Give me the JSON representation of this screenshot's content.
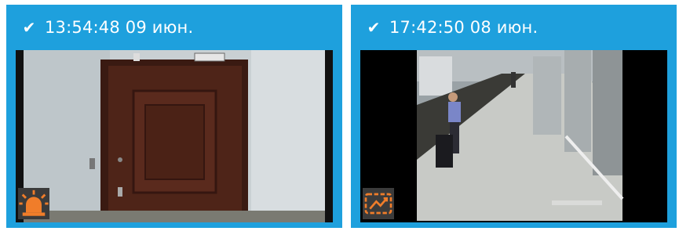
{
  "cards": [
    {
      "timestamp": "13:54:48 09 июн.",
      "status_icon": "checkmark-icon",
      "event_icon": "alarm-siren-icon",
      "event_icon_color": "#f07d2a"
    },
    {
      "timestamp": "17:42:50 08 июн.",
      "status_icon": "checkmark-icon",
      "event_icon": "scene-change-icon",
      "event_icon_color": "#f07d2a"
    }
  ],
  "colors": {
    "card_background": "#1ea0dd",
    "header_text": "#ffffff",
    "badge_background": "#3b3b3b"
  }
}
